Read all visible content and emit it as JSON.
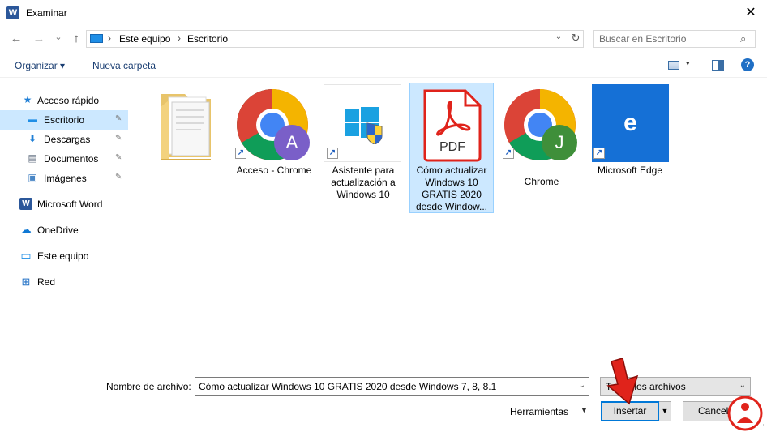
{
  "window": {
    "title": "Examinar",
    "app_icon_letter": "W",
    "close_glyph": "✕"
  },
  "nav": {
    "back_glyph": "←",
    "forward_glyph": "→",
    "recent_glyph": "⌄",
    "up_glyph": "↑"
  },
  "address": {
    "crumbs": [
      "Este equipo",
      "Escritorio"
    ],
    "sep": "›",
    "dropdown_glyph": "⌄",
    "refresh_glyph": "↻"
  },
  "search": {
    "placeholder": "Buscar en Escritorio",
    "icon_glyph": "⌕"
  },
  "toolbar": {
    "organize_label": "Organizar ▾",
    "new_folder_label": "Nueva carpeta",
    "view_dd": "▾",
    "help_glyph": "?"
  },
  "sidebar": {
    "items": [
      {
        "label": "Acceso rápido",
        "icon": "star-icon",
        "glyph": "★",
        "color": "#1f7fd6"
      },
      {
        "label": "Escritorio",
        "icon": "desktop-icon",
        "glyph": "▬",
        "color": "#1e8ee6",
        "pinned": true,
        "selected": true
      },
      {
        "label": "Descargas",
        "icon": "download-icon",
        "glyph": "⬇",
        "color": "#1f7fd6",
        "pinned": true
      },
      {
        "label": "Documentos",
        "icon": "document-icon",
        "glyph": "▤",
        "color": "#6e7a8a",
        "pinned": true
      },
      {
        "label": "Imágenes",
        "icon": "pictures-icon",
        "glyph": "▣",
        "color": "#4a86c5",
        "pinned": true
      },
      {
        "label": "Microsoft Word",
        "icon": "word-icon",
        "glyph": "W",
        "color": "#2b579a"
      },
      {
        "label": "OneDrive",
        "icon": "onedrive-icon",
        "glyph": "☁",
        "color": "#0f78d4"
      },
      {
        "label": "Este equipo",
        "icon": "computer-icon",
        "glyph": "▭",
        "color": "#1e8ee6"
      },
      {
        "label": "Red",
        "icon": "network-icon",
        "glyph": "⊞",
        "color": "#1f6fc5"
      }
    ],
    "pin_glyph": "✎"
  },
  "files": [
    {
      "name": "",
      "icon": "folder-icon"
    },
    {
      "name": "Acceso - Chrome",
      "icon": "chrome-icon",
      "avatar": "A",
      "avatar_color": "#7a5fc8",
      "shortcut": true
    },
    {
      "name": "Asistente para actualización a Windows 10",
      "icon": "windows-shield-icon",
      "shortcut": true
    },
    {
      "name": "Cómo actualizar Windows 10 GRATIS 2020 desde Window...",
      "icon": "pdf-icon",
      "pdf_label": "PDF",
      "selected": true
    },
    {
      "name": "Chrome",
      "icon": "chrome-icon",
      "avatar": "J",
      "avatar_color": "#3f8f3a",
      "shortcut": true
    },
    {
      "name": "Microsoft Edge",
      "icon": "edge-icon",
      "edge_letter": "e",
      "shortcut": true
    }
  ],
  "shortcut_glyph": "↗",
  "bottom": {
    "filename_label": "Nombre de archivo:",
    "filename_value": "Cómo actualizar Windows 10 GRATIS 2020 desde Windows 7, 8, 8.1",
    "filetype_value": "Todos los archivos",
    "dd_glyph": "⌄",
    "tools_label": "Herramientas",
    "tools_dd": "▼",
    "insert_label": "Insertar",
    "insert_dd": "▼",
    "cancel_label": "Cancelar"
  },
  "colors": {
    "selection": "#cce8ff",
    "accent": "#0078d7",
    "arrow": "#e0231b"
  }
}
